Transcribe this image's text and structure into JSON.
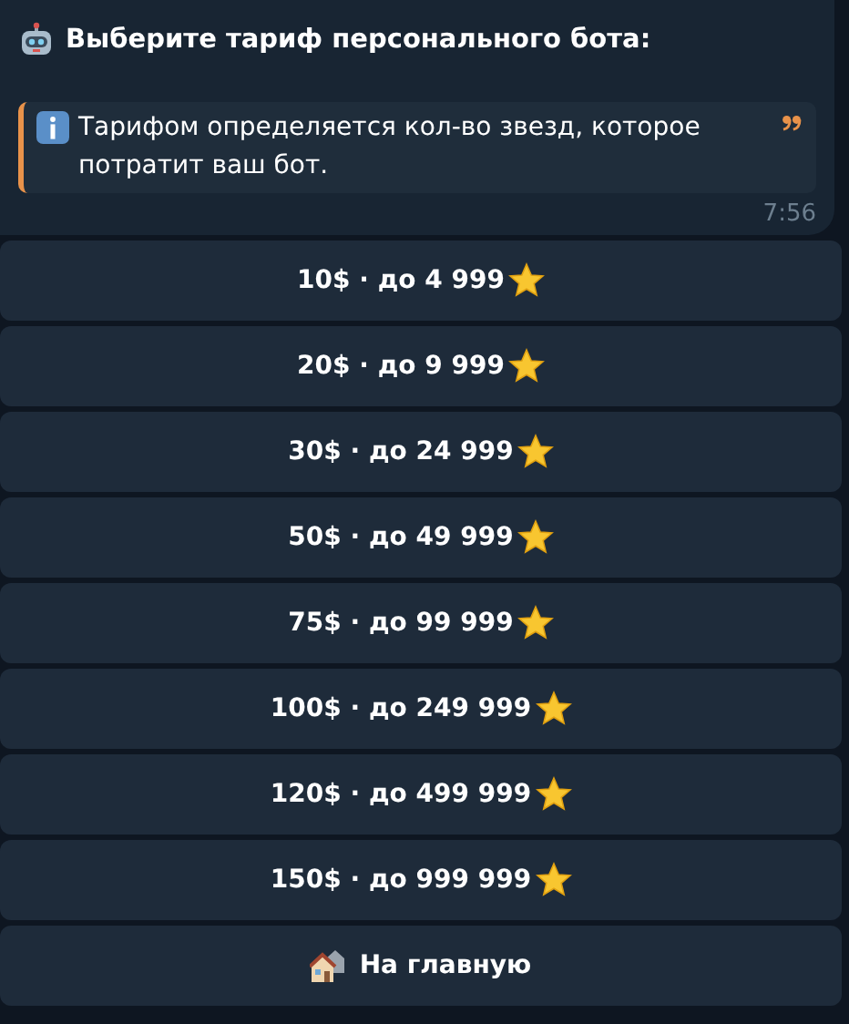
{
  "message": {
    "title": "Выберите тариф персонального бота:",
    "quote": "Тарифом определяется кол-во звезд, которое потратит ваш бот.",
    "time": "7:56"
  },
  "buttons": [
    {
      "label": "10$ · до 4 999",
      "kind": "tariff"
    },
    {
      "label": "20$ · до 9 999",
      "kind": "tariff"
    },
    {
      "label": "30$ · до 24 999",
      "kind": "tariff"
    },
    {
      "label": "50$ · до 49 999",
      "kind": "tariff"
    },
    {
      "label": "75$ · до 99 999",
      "kind": "tariff"
    },
    {
      "label": "100$ · до 249 999",
      "kind": "tariff"
    },
    {
      "label": "120$ · до 499 999",
      "kind": "tariff"
    },
    {
      "label": "150$ · до 999 999",
      "kind": "tariff"
    },
    {
      "label": "На главную",
      "kind": "home"
    }
  ]
}
